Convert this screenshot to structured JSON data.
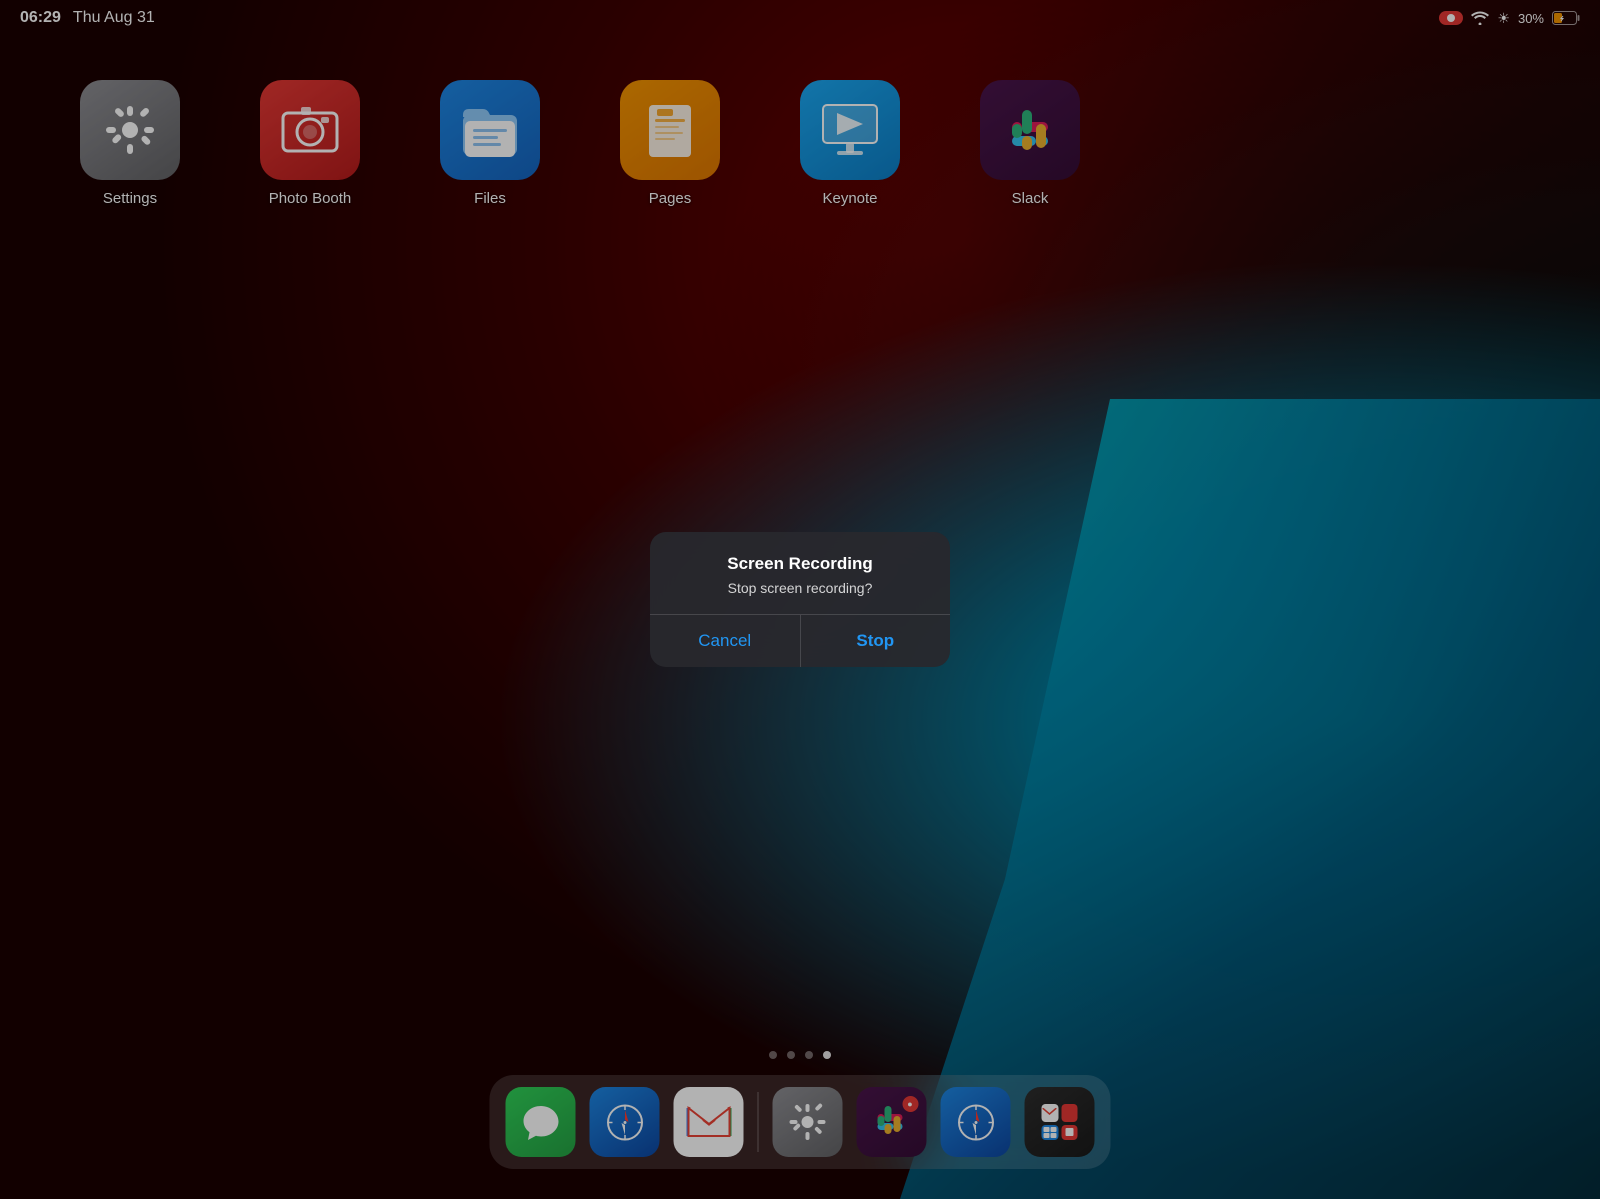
{
  "statusBar": {
    "time": "06:29",
    "date": "Thu Aug 31",
    "battery": "30%",
    "recordingIndicator": true
  },
  "apps": [
    {
      "id": "settings",
      "label": "Settings",
      "iconType": "settings"
    },
    {
      "id": "photobooth",
      "label": "Photo Booth",
      "iconType": "photobooth"
    },
    {
      "id": "files",
      "label": "Files",
      "iconType": "files"
    },
    {
      "id": "pages",
      "label": "Pages",
      "iconType": "pages"
    },
    {
      "id": "keynote",
      "label": "Keynote",
      "iconType": "keynote"
    },
    {
      "id": "slack",
      "label": "Slack",
      "iconType": "slack"
    }
  ],
  "dialog": {
    "title": "Screen Recording",
    "message": "Stop screen recording?",
    "cancelLabel": "Cancel",
    "stopLabel": "Stop"
  },
  "pageDots": {
    "total": 4,
    "active": 3
  },
  "dock": {
    "mainApps": [
      {
        "id": "messages",
        "iconType": "messages"
      },
      {
        "id": "safari",
        "iconType": "safari"
      },
      {
        "id": "gmail",
        "iconType": "gmail"
      }
    ],
    "secondaryApps": [
      {
        "id": "dock-settings",
        "iconType": "dock-settings"
      },
      {
        "id": "dock-slack",
        "iconType": "dock-slack"
      },
      {
        "id": "dock-safari2",
        "iconType": "dock-safari2"
      },
      {
        "id": "dock-multiapp",
        "iconType": "dock-multiapp"
      }
    ]
  }
}
